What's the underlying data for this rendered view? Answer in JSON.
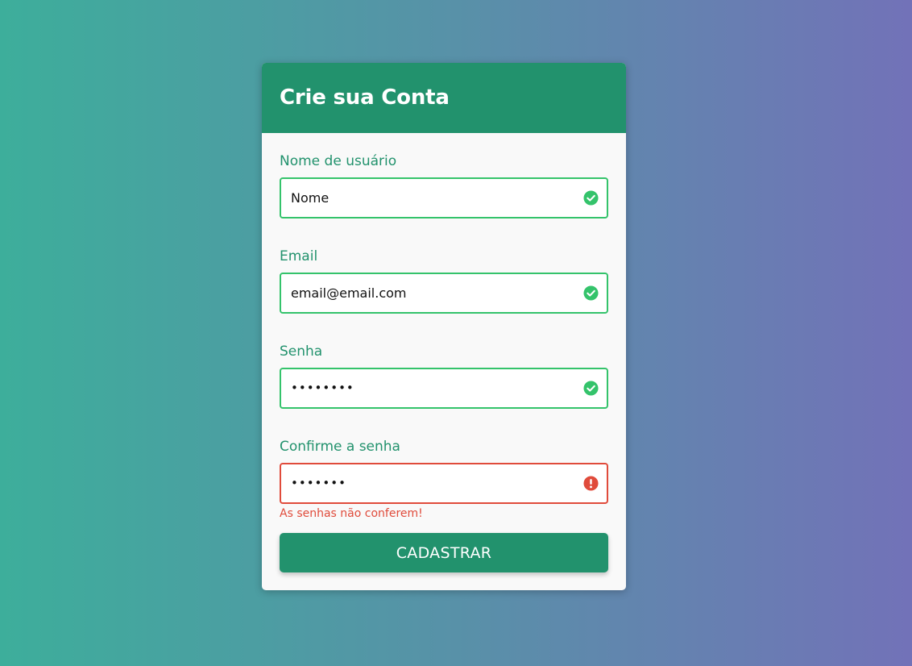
{
  "form": {
    "title": "Crie sua Conta",
    "fields": [
      {
        "label": "Nome de usuário",
        "value": "Nome",
        "status": "valid",
        "icon": "check-circle-icon"
      },
      {
        "label": "Email",
        "value": "email@email.com",
        "status": "valid",
        "icon": "check-circle-icon"
      },
      {
        "label": "Senha",
        "value": "••••••••",
        "status": "valid",
        "icon": "check-circle-icon"
      },
      {
        "label": "Confirme a senha",
        "value": "•••••••",
        "status": "error",
        "icon": "exclamation-circle-icon",
        "error_message": "As senhas não conferem!"
      }
    ],
    "submit_label": "CADASTRAR"
  },
  "colors": {
    "primary": "#22926d",
    "success": "#34c36b",
    "error": "#e04b3b",
    "card_background": "#f9f9f9",
    "gradient_start": "#3dae9b",
    "gradient_end": "#7272b8"
  }
}
